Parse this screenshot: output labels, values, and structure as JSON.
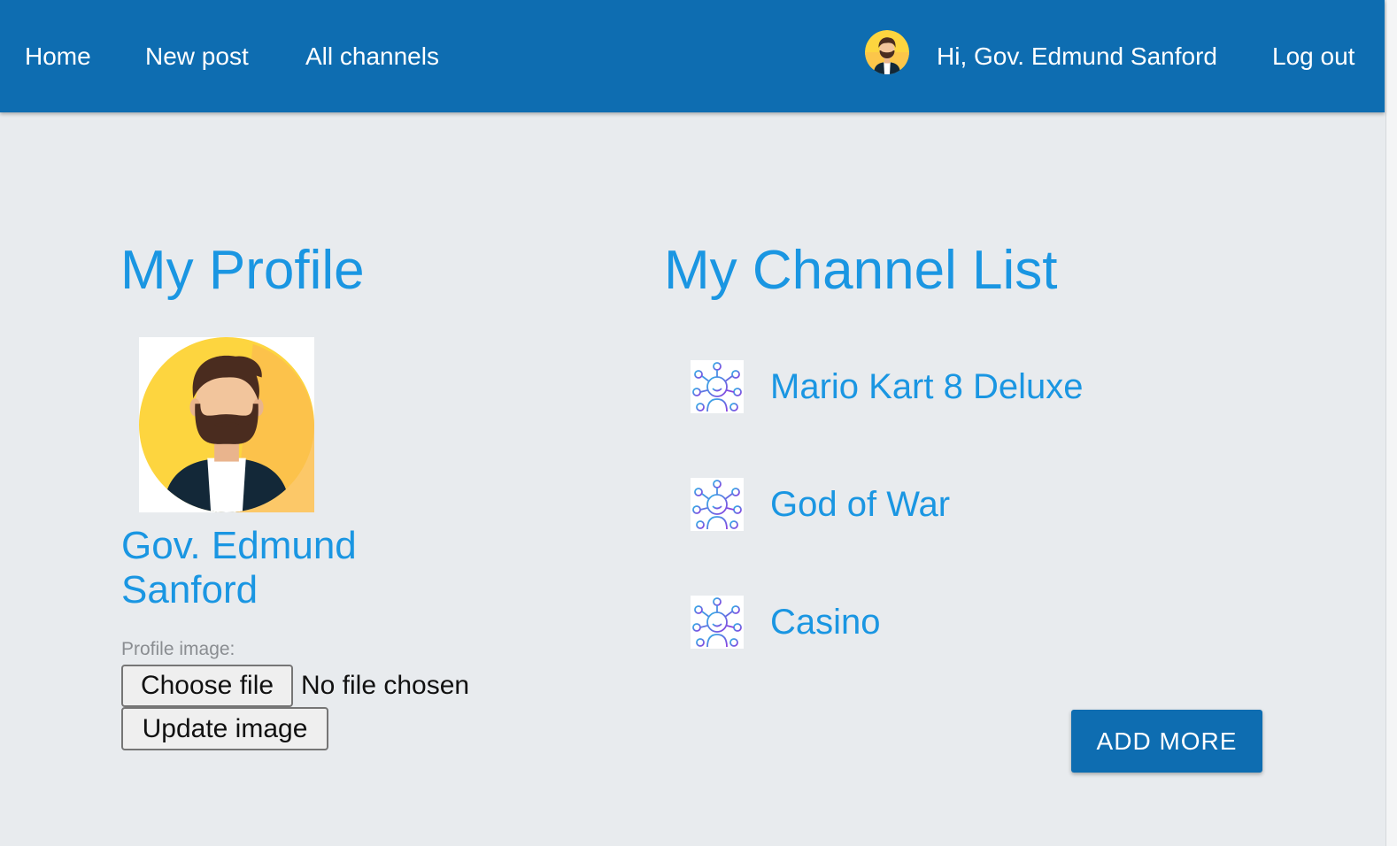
{
  "nav": {
    "home": "Home",
    "new_post": "New post",
    "all_channels": "All channels",
    "greeting": "Hi, Gov. Edmund Sanford",
    "logout": "Log out",
    "avatar_icon": "bearded-man-avatar-icon"
  },
  "profile": {
    "title": "My Profile",
    "name": "Gov. Edmund Sanford",
    "image_label": "Profile image:",
    "choose_file": "Choose file",
    "file_status": "No file chosen",
    "update_image": "Update image"
  },
  "channels": {
    "title": "My Channel List",
    "icon": "community-network-icon",
    "items": [
      {
        "label": "Mario Kart 8 Deluxe"
      },
      {
        "label": "God of War"
      },
      {
        "label": "Casino"
      }
    ],
    "add_more": "ADD MORE"
  },
  "colors": {
    "header": "#0e6db1",
    "accent": "#1a96e2",
    "background": "#e8ebee",
    "avatar_yellow": "#fdd53f"
  }
}
